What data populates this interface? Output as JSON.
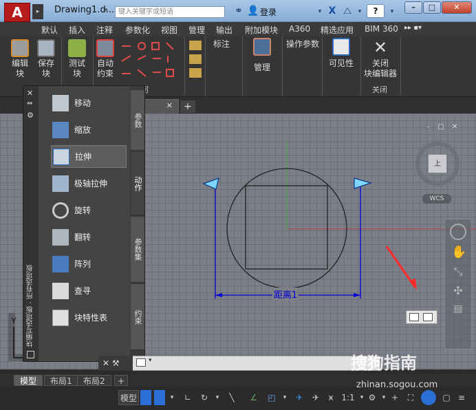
{
  "app": {
    "logo_letter": "A",
    "document_title": "Drawing1.d...",
    "search_placeholder": "键入关键字或短语",
    "login_label": "登录",
    "help_label": "?",
    "window_minimize": "–",
    "window_maximize": "□",
    "window_close": "✕"
  },
  "menu_tabs": [
    "默认",
    "插入",
    "注释",
    "参数化",
    "视图",
    "管理",
    "输出",
    "附加模块",
    "A360",
    "精选应用",
    "BIM 360"
  ],
  "ribbon": {
    "edit_block": "编辑\n块",
    "save_block": "保存\n块",
    "test_block": "测试\n块",
    "auto_constrain": "自动\n约束",
    "group_label_fragment": "何",
    "annotation": "标注",
    "manage": "管理",
    "action_params": "操作参数",
    "visibility": "可见性",
    "close_block_editor": "关闭\n块编辑器",
    "close_group": "关闭"
  },
  "palette": {
    "title": "块编写选项板 - 所有选项板",
    "tools": [
      "移动",
      "缩放",
      "拉伸",
      "极轴拉伸",
      "旋转",
      "翻转",
      "阵列",
      "查寻",
      "块特性表"
    ],
    "selected_index": 2,
    "side_tabs": [
      "参数",
      "动作",
      "参数集",
      "约束"
    ],
    "active_side_tab": "动作"
  },
  "drawing": {
    "dimension_label": "距离1"
  },
  "viewcube": {
    "face": "上",
    "wcs": "WCS"
  },
  "layout_tabs": [
    "模型",
    "布局1",
    "布局2"
  ],
  "layout_add": "+",
  "status": {
    "model_label": "模型",
    "scale_label": "1:1"
  },
  "watermark": {
    "text": "搜狗指南",
    "url": "zhinan.sogou.com"
  },
  "colors": {
    "accent_red": "#b71c1c",
    "dimension_blue": "#0000d6",
    "grip_cyan": "#7fd6ff",
    "arrow_red": "#ff2a2a"
  }
}
